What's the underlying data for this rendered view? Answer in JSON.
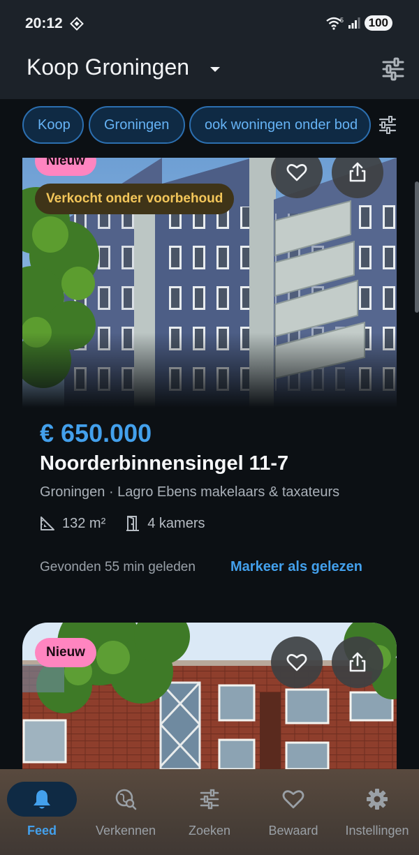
{
  "status_bar": {
    "time": "20:12",
    "battery": "100",
    "network": "5"
  },
  "app_bar": {
    "title": "Koop Groningen"
  },
  "chips": [
    "Koop",
    "Groningen",
    "ook woningen onder bod"
  ],
  "listings": [
    {
      "badge_new": "Nieuw",
      "badge_status": "Verkocht onder voorbehoud",
      "price": "€ 650.000",
      "address": "Noorderbinnensingel 11-7",
      "meta": "Groningen · Lagro Ebens makelaars & taxateurs",
      "area": "132 m²",
      "rooms": "4 kamers",
      "found": "Gevonden 55 min geleden",
      "mark_read": "Markeer als gelezen"
    },
    {
      "badge_new": "Nieuw"
    }
  ],
  "bottom_nav": [
    {
      "label": "Feed",
      "icon": "bell-icon",
      "active": true
    },
    {
      "label": "Verkennen",
      "icon": "explore-icon",
      "active": false
    },
    {
      "label": "Zoeken",
      "icon": "sliders-icon",
      "active": false
    },
    {
      "label": "Bewaard",
      "icon": "heart-icon",
      "active": false
    },
    {
      "label": "Instellingen",
      "icon": "gear-icon",
      "active": false
    }
  ],
  "colors": {
    "accent": "#43a0ec",
    "badge_new": "#ff85c0",
    "badge_sold_text": "#f3c65a",
    "background": "#0c1014"
  }
}
